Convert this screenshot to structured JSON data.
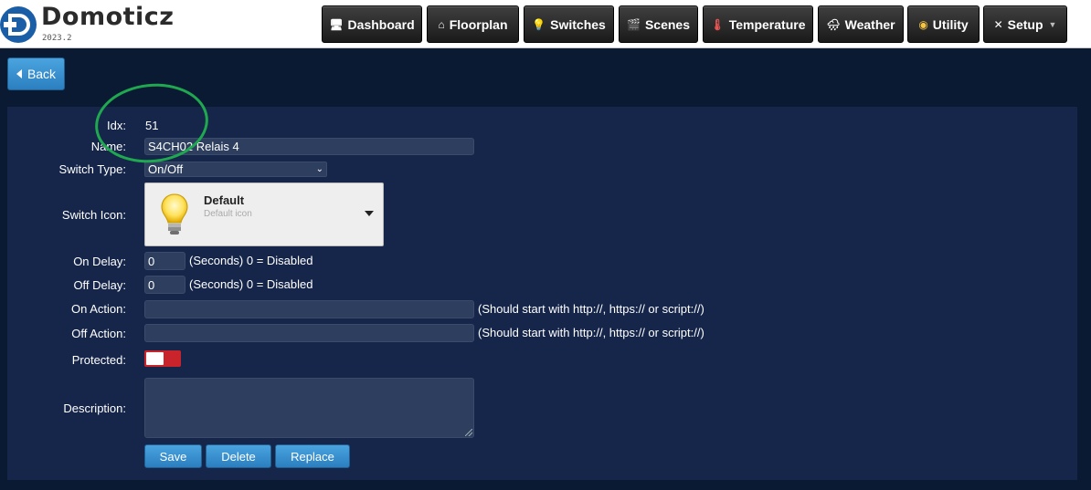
{
  "app": {
    "name": "Domoticz",
    "version": "2023.2"
  },
  "nav": [
    {
      "label": "Dashboard",
      "icon": "dashboard-icon"
    },
    {
      "label": "Floorplan",
      "icon": "floorplan-icon"
    },
    {
      "label": "Switches",
      "icon": "bulb-icon"
    },
    {
      "label": "Scenes",
      "icon": "clapperboard-icon"
    },
    {
      "label": "Temperature",
      "icon": "thermometer-icon"
    },
    {
      "label": "Weather",
      "icon": "cloud-rain-icon"
    },
    {
      "label": "Utility",
      "icon": "utility-icon"
    },
    {
      "label": "Setup",
      "icon": "tools-icon"
    }
  ],
  "back": {
    "label": "Back"
  },
  "form": {
    "idx_label": "Idx:",
    "idx_value": "51",
    "name_label": "Name:",
    "name_value": "S4CH02 Relais 4",
    "switch_type_label": "Switch Type:",
    "switch_type_value": "On/Off",
    "switch_icon_label": "Switch Icon:",
    "icon_title": "Default",
    "icon_subtitle": "Default icon",
    "on_delay_label": "On Delay:",
    "on_delay_value": "0",
    "off_delay_label": "Off Delay:",
    "off_delay_value": "0",
    "delay_note": "(Seconds) 0 = Disabled",
    "on_action_label": "On Action:",
    "off_action_label": "Off Action:",
    "action_note": "(Should start with http://, https:// or script://)",
    "protected_label": "Protected:",
    "description_label": "Description:"
  },
  "buttons": {
    "save": "Save",
    "delete": "Delete",
    "replace": "Replace"
  },
  "colors": {
    "accent": "#2b7fc0",
    "background": "#0b1a33",
    "panel": "#16264a",
    "annotation": "#1fa84f",
    "toggle_off": "#c9242b"
  }
}
